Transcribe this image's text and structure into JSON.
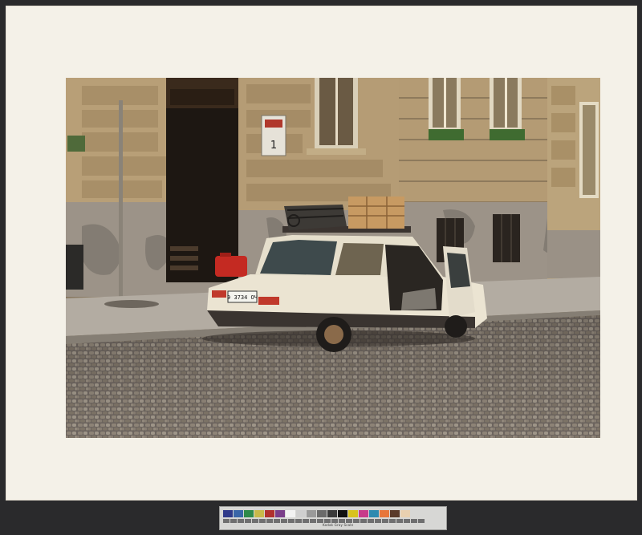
{
  "photo": {
    "license_plate": "Э 3734 ОЧ",
    "house_sign": "1"
  },
  "target": {
    "label": "Kodak Gray Scale",
    "patches": [
      "#2f3a8a",
      "#3a66a8",
      "#2f8a4a",
      "#c8b94a",
      "#b0302e",
      "#7a3e8a",
      "#f2f2f2",
      "#cfcfcf",
      "#9a9a9a",
      "#6a6a6a",
      "#3a3a3a",
      "#111111",
      "#d8c21f",
      "#c83a8a",
      "#2e8ab0",
      "#e8763a",
      "#5a3a2a",
      "#e9d0b0"
    ]
  }
}
